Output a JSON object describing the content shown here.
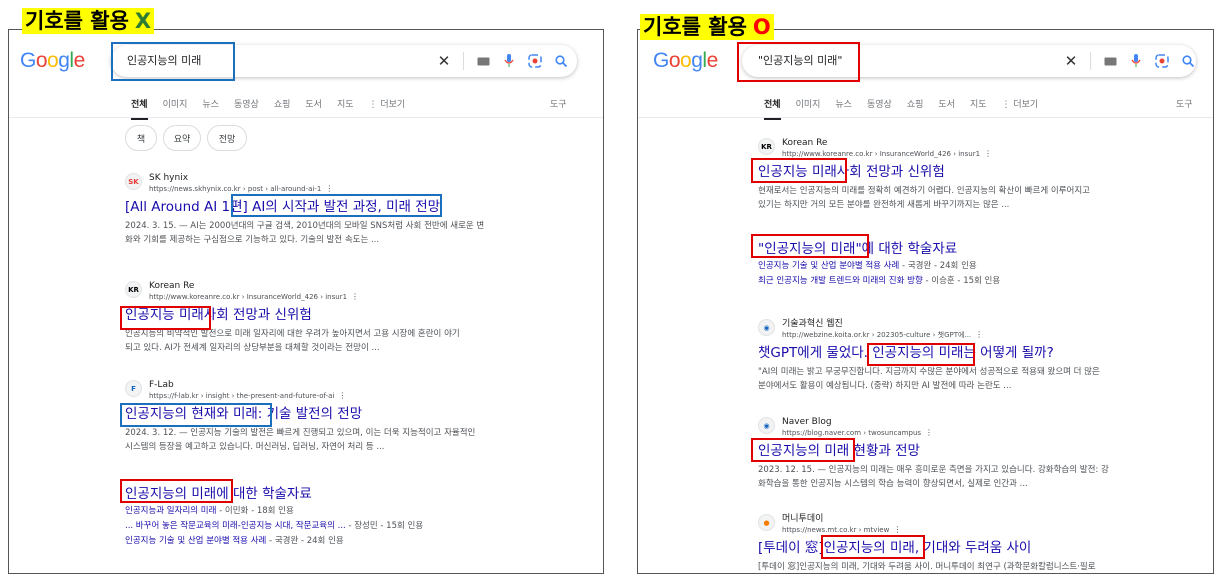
{
  "labels": {
    "left": {
      "text": "기호를 활용",
      "mark": "X",
      "mark_color": "#2e7d32"
    },
    "right": {
      "text": "기호를 활용",
      "mark": "O",
      "mark_color": "#ff0000"
    }
  },
  "brand": {
    "google_letters": [
      "G",
      "o",
      "o",
      "g",
      "l",
      "e"
    ],
    "google_colors": [
      "#4285f4",
      "#ea4335",
      "#fbbc05",
      "#4285f4",
      "#34a853",
      "#ea4335"
    ]
  },
  "left": {
    "query": "인공지능의 미래",
    "tabs": [
      "전체",
      "이미지",
      "뉴스",
      "동영상",
      "쇼핑",
      "도서",
      "지도",
      "⋮ 더보기"
    ],
    "tools": "도구",
    "chips": [
      "책",
      "요약",
      "전망"
    ],
    "results": [
      {
        "fav": "SK",
        "site": "SK hynix",
        "url": "https://news.skhynix.co.kr › post › all-around-ai-1",
        "title": "[All Around AI 1편] AI의 시작과 발전 과정, 미래 전망",
        "snippet": [
          "2024. 3. 15. — AI는 2000년대의 구글 검색, 2010년대의 모바일 SNS처럼 사회 전반에 새로운 변",
          "화와 기회를 제공하는 구심점으로 기능하고 있다. 기술의 발전 속도는 ..."
        ]
      },
      {
        "fav": "KR",
        "site": "Korean Re",
        "url": "http://www.koreanre.co.kr › InsuranceWorld_426 › insur1",
        "title": "인공지능 미래사회 전망과 신위험",
        "snippet": [
          "인공지능의 비약적인 발전으로 미래 일자리에 대한 우려가 높아지면서 고용 시장에 혼란이 야기",
          "되고 있다. AI가 전세계 일자리의 상당부분을 대체할 것이라는 전망이 ..."
        ]
      },
      {
        "fav": "F",
        "site": "F-Lab",
        "url": "https://f-lab.kr › insight › the-present-and-future-of-ai",
        "title": "인공지능의 현재와 미래: 기술 발전의 전망",
        "snippet": [
          "2024. 3. 12. — 인공지능 기술의 발전은 빠르게 진행되고 있으며, 이는 더욱 지능적이고 자율적인",
          "시스템의 등장을 예고하고 있습니다. 머신러닝, 딥러닝, 자연어 처리 등 ..."
        ]
      },
      {
        "title": "인공지능의 미래에 대한 학술자료",
        "subs": [
          {
            "link": "인공지능과 일자리의 미래",
            "meta": " - 이민화 - 18회 인용"
          },
          {
            "link": "... 바꾸어 놓은 작문교육의 미래-인공지능 시대, 작문교육의 ...",
            "meta": " - 장성민 - 15회 인용"
          },
          {
            "link": "인공지능 기술 및 산업 분야별 적용 사례",
            "meta": " - 국경완 - 24회 인용"
          }
        ]
      }
    ]
  },
  "right": {
    "query": "\"인공지능의 미래\"",
    "tabs": [
      "전체",
      "이미지",
      "뉴스",
      "동영상",
      "쇼핑",
      "도서",
      "지도",
      "⋮ 더보기"
    ],
    "tools": "도구",
    "results": [
      {
        "fav": "KR",
        "site": "Korean Re",
        "url": "http://www.koreanre.co.kr › InsuranceWorld_426 › insur1",
        "title": "인공지능 미래사회 전망과 신위험",
        "snippet": [
          "현재로서는 인공지능의 미래를 정확히 예견하기 어렵다. 인공지능의 확산이 빠르게 이루어지고",
          "있기는 하지만 거의 모든 분야를 완전하게 새롭게 바꾸기까지는 많은 ..."
        ]
      },
      {
        "title": "\"인공지능의 미래\"에 대한 학술자료",
        "subs": [
          {
            "link": "인공지능 기술 및 산업 분야별 적용 사례",
            "meta": " - 국경완 - 24회 인용"
          },
          {
            "link": "최근 인공지능 개발 트렌드와 미래의 진화 방향",
            "meta": " - 이승훈 - 15회 인용"
          }
        ]
      },
      {
        "fav": "◉",
        "site": "기술과혁신 웹진",
        "url": "http://webzine.koita.or.kr › 202305-culture › 챗GPT에...",
        "title": "챗GPT에게 물었다. 인공지능의 미래는 어떻게 될까?",
        "snippet": [
          "\"AI의 미래는 밝고 무궁무진합니다. 지금까지 수많은 분야에서 성공적으로 적용돼 왔으며 더 많은",
          "분야에서도 활용이 예상됩니다. (중략) 하지만 AI 발전에 따라 논란도 ..."
        ]
      },
      {
        "fav": "◉",
        "site": "Naver Blog",
        "url": "https://blog.naver.com › twosuncampus",
        "title": "인공지능의 미래 현황과 전망",
        "snippet": [
          "2023. 12. 15. — 인공지능의 미래는 매우 흥미로운 측면을 가지고 있습니다. 강화학습의 발전: 강",
          "화학습을 통한 인공지능 시스템의 학습 능력이 향상되면서, 실제로 인간과 ..."
        ]
      },
      {
        "fav": "●",
        "site": "머니투데이",
        "url": "https://news.mt.co.kr › mtview",
        "title": "[투데이 窓]인공지능의 미래, 기대와 두려움 사이",
        "snippet": [
          "[투데이 窓]인공지능의 미래, 기대와 두려움 사이. 머니투데이 최연구 (과학문화칼럼니스트·필로"
        ]
      }
    ]
  }
}
